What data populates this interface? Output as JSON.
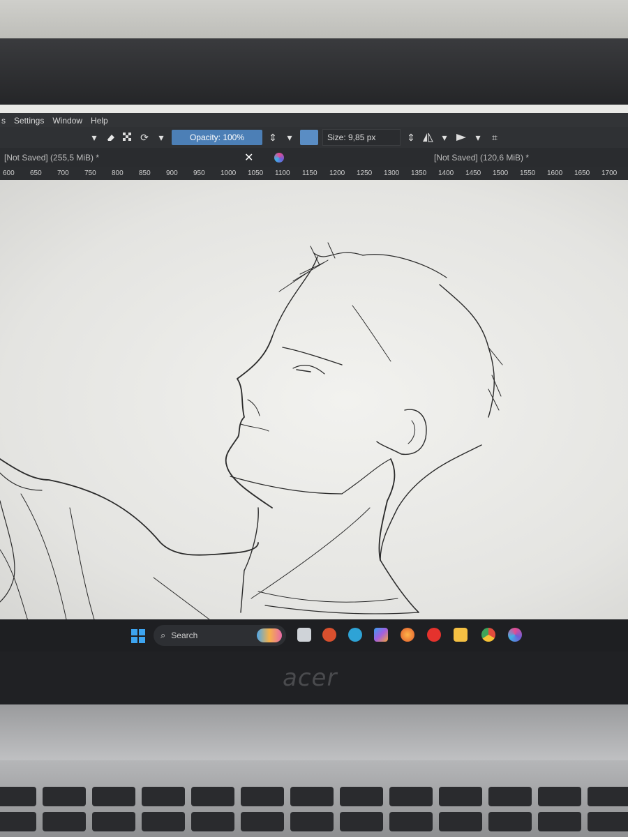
{
  "menu": {
    "items": [
      "s",
      "Settings",
      "Window",
      "Help"
    ]
  },
  "toolbar": {
    "opacity_label": "Opacity: 100%",
    "size_label": "Size: 9,85 px",
    "icons": [
      "eraser-icon",
      "checker-pattern-icon",
      "reload-icon",
      "mirror-horizontal-icon",
      "mirror-vertical-icon",
      "crop-icon"
    ]
  },
  "tabs": {
    "left_doc": "[Not Saved]  (255,5 MiB) *",
    "close_symbol": "✕",
    "right_doc": "[Not Saved]  (120,6 MiB) *"
  },
  "ruler": {
    "ticks": [
      "600",
      "650",
      "700",
      "750",
      "800",
      "850",
      "900",
      "950",
      "1000",
      "1050",
      "1100",
      "1150",
      "1200",
      "1250",
      "1300",
      "1350",
      "1400",
      "1450",
      "1500",
      "1550",
      "1600",
      "1650",
      "1700"
    ]
  },
  "taskbar": {
    "search_label": "Search",
    "apps": [
      "file-icon",
      "brave-icon",
      "edge-icon",
      "copilot-icon",
      "firefox-icon",
      "opera-icon",
      "folder-icon",
      "chrome-icon",
      "krita-icon"
    ]
  },
  "laptop": {
    "brand": "acer"
  },
  "colors": {
    "accent": "#4c7fb6",
    "toolbar_bg": "#2f3134",
    "canvas_bg": "#ebebe8"
  }
}
